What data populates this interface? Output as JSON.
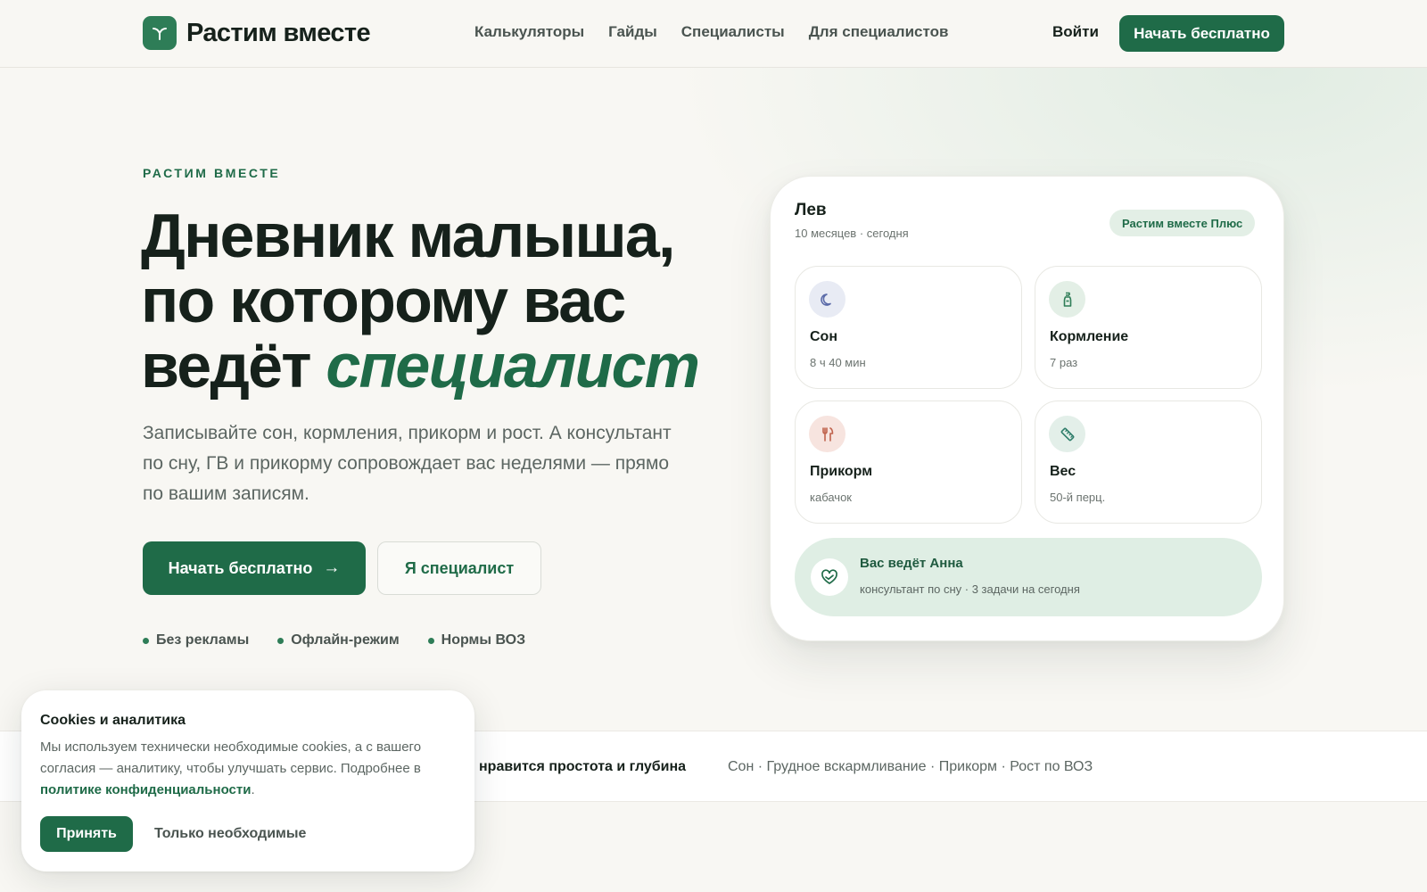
{
  "header": {
    "logo_text": "Растим вместе",
    "nav": [
      "Калькуляторы",
      "Гайды",
      "Специалисты",
      "Для специалистов"
    ],
    "login": "Войти",
    "cta": "Начать бесплатно"
  },
  "hero": {
    "eyebrow": "РАСТИМ ВМЕСТЕ",
    "headline_part1": "Дневник малыша, по которому вас ведёт ",
    "headline_accent": "специалист",
    "subtitle": "Записывайте сон, кормления, прикорм и рост. А консультант по сну, ГВ и прикорму сопровождает вас неделями — прямо по вашим записям.",
    "primary_cta": "Начать бесплатно",
    "secondary_cta": "Я специалист",
    "features": [
      "Без рекламы",
      "Офлайн-режим",
      "Нормы ВОЗ"
    ]
  },
  "card": {
    "child_name": "Лев",
    "child_meta": "10 месяцев · сегодня",
    "plan_badge": "Растим вместе Плюс",
    "tiles": [
      {
        "title": "Сон",
        "value": "8 ч 40 мин",
        "icon": "moon-icon",
        "color": "#5a6aa8"
      },
      {
        "title": "Кормление",
        "value": "7 раз",
        "icon": "bottle-icon",
        "color": "#2e7d57"
      },
      {
        "title": "Прикорм",
        "value": "кабачок",
        "icon": "utensils-icon",
        "color": "#c0634d"
      },
      {
        "title": "Вес",
        "value": "50-й перц.",
        "icon": "ruler-icon",
        "color": "#2e7d6a"
      }
    ],
    "specialist": {
      "title": "Вас ведёт Анна",
      "meta": "консультант по сну · 3 задачи на сегодня",
      "icon": "heart-hand-icon"
    }
  },
  "strip": {
    "left_text": "нравится простота и глубина",
    "right_text": "Сон · Грудное вскармливание · Прикорм · Рост по ВОЗ"
  },
  "cookie": {
    "title": "Cookies и аналитика",
    "text": "Мы используем технически необходимые cookies, а с вашего согласия — аналитику, чтобы улучшать сервис. Подробнее в ",
    "link": "политике конфиденциальности",
    "text_end": ".",
    "accept": "Принять",
    "necessary": "Только необходимые"
  },
  "colors": {
    "brand": "#1f6b48",
    "background": "#f8f7f3",
    "accent_light": "#dfeee4"
  }
}
